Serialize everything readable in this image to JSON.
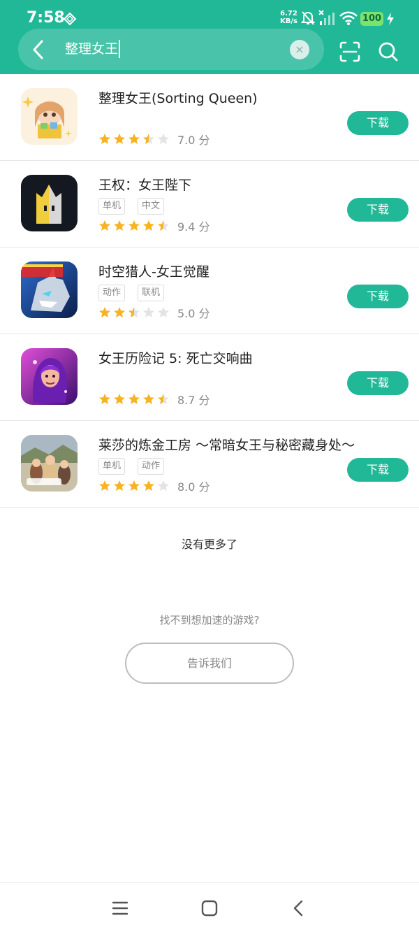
{
  "status_bar": {
    "time": "7:58",
    "net_speed": "6.72",
    "net_unit": "KB/s",
    "battery": "100"
  },
  "search": {
    "query": "整理女王",
    "clear_symbol": "×"
  },
  "results": [
    {
      "title": "整理女王(Sorting Queen)",
      "tags": [],
      "rating": 3.5,
      "score": "7.0 分",
      "button": "下载",
      "icon": "sorting-queen-icon"
    },
    {
      "title": "王权：女王陛下",
      "tags": [
        "单机",
        "中文"
      ],
      "rating": 4.5,
      "score": "9.4 分",
      "button": "下载",
      "icon": "reigns-icon"
    },
    {
      "title": "时空猎人-女王觉醒",
      "tags": [
        "动作",
        "联机"
      ],
      "rating": 2.5,
      "score": "5.0 分",
      "button": "下载",
      "icon": "time-hunter-icon"
    },
    {
      "title": "女王历险记 5: 死亡交响曲",
      "tags": [],
      "rating": 4.5,
      "score": "8.7 分",
      "button": "下载",
      "icon": "queen-adventure-icon"
    },
    {
      "title": "莱莎的炼金工房 ～常暗女王与秘密藏身处～",
      "tags": [
        "单机",
        "动作"
      ],
      "rating": 4,
      "score": "8.0 分",
      "button": "下载",
      "icon": "atelier-ryza-icon"
    }
  ],
  "footer": {
    "no_more": "没有更多了",
    "cant_find": "找不到想加速的游戏?",
    "tell_us": "告诉我们"
  },
  "colors": {
    "accent": "#21b898",
    "star": "#f7b320",
    "star_empty": "#e3e3e3"
  }
}
